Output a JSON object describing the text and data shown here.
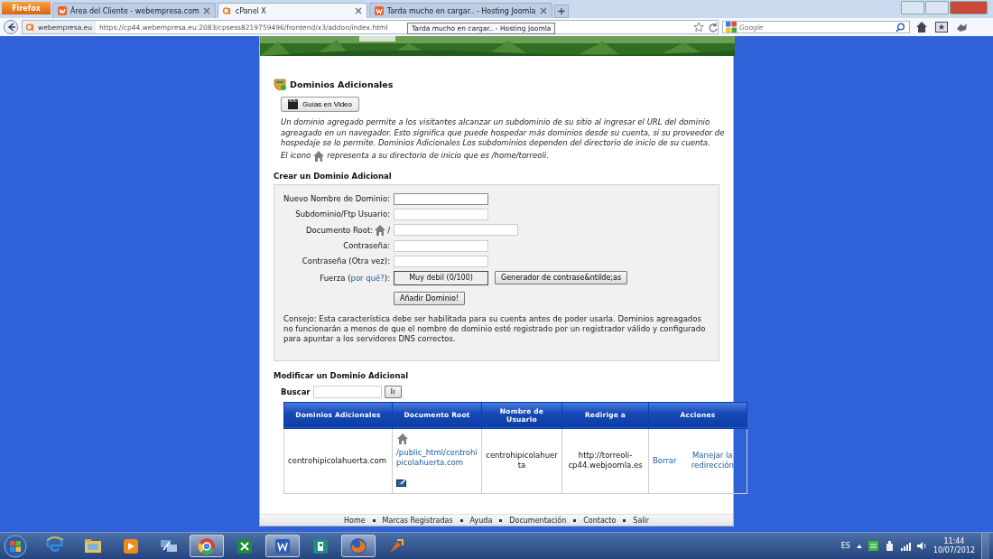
{
  "browser": {
    "menu_button": "Firefox",
    "tabs": [
      {
        "kind": "w",
        "title": "Área del Cliente - webempresa.com",
        "selected": false
      },
      {
        "kind": "cp",
        "title": "cPanel X",
        "selected": true
      },
      {
        "kind": "w",
        "title": "Tarda mucho en cargar.. - Hosting Joomla",
        "selected": false
      }
    ],
    "site_identity": "webempresa.eu",
    "url": "https://cp44.webempresa.eu:2083/cpsess8219759496/frontend/x3/addon/index.html",
    "tooltip": "Tarda mucho en cargar.. - Hosting Joomla",
    "search": {
      "placeholder": "Google"
    }
  },
  "page": {
    "title": "Dominios Adicionales",
    "video_button": "Guías en Video",
    "intro": [
      "Un dominio agregado permite a los visitantes alcanzar un subdominio de su sitio al ingresar el URL del dominio agreagado en un navegador. Esto significa que puede hospedar más dominios desde su cuenta, si su proveedor de hospedaje se lo permite. Dominios Adicionales Los subdominios dependen del directorio de inicio de su cuenta.",
      "El icono",
      "representa a su directorio de inicio que es /home/torreoli."
    ],
    "create": {
      "heading": "Crear un Dominio Adicional",
      "fields": [
        {
          "kind": "text",
          "label": "Nuevo Nombre de Dominio:",
          "focused": true
        },
        {
          "kind": "text",
          "label": "Subdominio/Ftp Usuario:",
          "focused": false
        },
        {
          "kind": "docroot",
          "label": "Documento Root:",
          "suffix": "/",
          "focused": false
        },
        {
          "kind": "text",
          "label": "Contraseña:",
          "focused": false
        },
        {
          "kind": "text",
          "label": "Contraseña (Otra vez):",
          "focused": false
        }
      ],
      "strength": {
        "label_before": "Fuerza (",
        "link": "por qué?",
        "label_after": "):",
        "meter": "Muy debil (0/100)",
        "generator_button": "Generador de contrase&ntilde;as"
      },
      "submit_button": "Añadir Dominio!",
      "tip": "Consejo: Esta característica debe ser habilitada para su cuenta antes de poder usarla. Dominios agreagados no funcionarán a menos de que el nombre de dominio esté registrado por un registrador válido y configurado para apuntar a los servidores DNS correctos."
    },
    "modify": {
      "heading": "Modificar un Dominio Adicional",
      "search_label": "Buscar",
      "search_button": "Ir",
      "table": {
        "columns": [
          "Dominios Adicionales",
          "Documento Root",
          "Nombre de Usuario",
          "Redirige a",
          "Acciones"
        ],
        "rows": [
          {
            "domain": "centrohipicolahuerta.com",
            "document_root": "/public_html/centrohipicolahuerta.com",
            "user": "centrohipicolahuerta",
            "redirect": "http://torreoli-cp44.webjoomla.es",
            "actions": [
              "Borrar",
              "Manejar la redirección"
            ]
          }
        ]
      }
    },
    "footer_links": [
      "Home",
      "Marcas Registradas",
      "Ayuda",
      "Documentación",
      "Contacto",
      "Salir"
    ]
  },
  "taskbar": {
    "apps": [
      {
        "kind": "ie",
        "active": false
      },
      {
        "kind": "folder",
        "active": false
      },
      {
        "kind": "media",
        "active": false
      },
      {
        "kind": "network",
        "active": false
      },
      {
        "kind": "chrome",
        "active": true
      },
      {
        "kind": "excel",
        "active": false
      },
      {
        "kind": "word",
        "active": true
      },
      {
        "kind": "publisher",
        "active": false
      },
      {
        "kind": "firefox",
        "active": true
      },
      {
        "kind": "tool",
        "active": false
      }
    ],
    "language": "ES",
    "time": "11:44",
    "date": "10/07/2012"
  }
}
